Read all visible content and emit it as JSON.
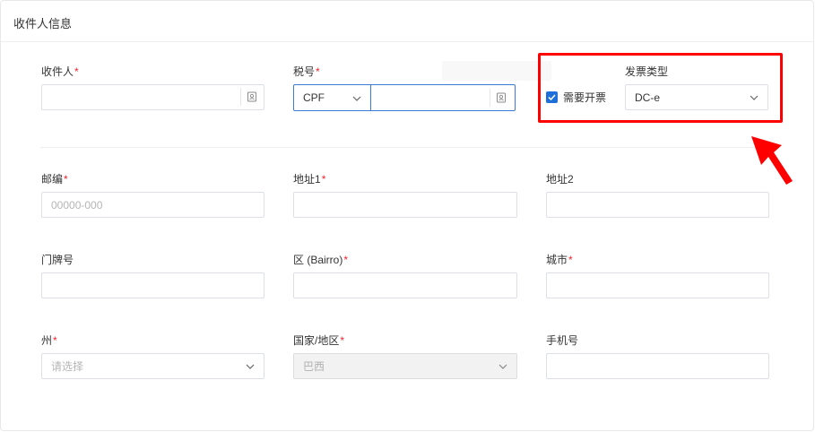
{
  "section": {
    "title": "收件人信息"
  },
  "required_mark": "*",
  "fields": {
    "recipient": {
      "label": "收件人",
      "value": "",
      "placeholder": ""
    },
    "tax": {
      "label": "税号",
      "type_value": "CPF",
      "value": "",
      "placeholder": ""
    },
    "invoice": {
      "checkbox_label": "需要开票",
      "checked": true,
      "type_label": "发票类型",
      "type_value": "DC-e"
    },
    "zip": {
      "label": "邮编",
      "value": "",
      "placeholder": "00000-000"
    },
    "address1": {
      "label": "地址1",
      "value": "",
      "placeholder": ""
    },
    "address2": {
      "label": "地址2",
      "value": "",
      "placeholder": ""
    },
    "house_number": {
      "label": "门牌号",
      "value": "",
      "placeholder": ""
    },
    "district": {
      "label": "区 (Bairro)",
      "value": "",
      "placeholder": ""
    },
    "city": {
      "label": "城市",
      "value": "",
      "placeholder": ""
    },
    "state": {
      "label": "州",
      "placeholder": "请选择"
    },
    "country": {
      "label": "国家/地区",
      "value": "巴西",
      "disabled": true
    },
    "phone": {
      "label": "手机号",
      "value": "",
      "placeholder": ""
    }
  },
  "icons": {
    "contact_book": "contact-book-icon",
    "chevron": "chevron-down-icon",
    "check": "check-icon",
    "annotation_arrow": "arrow-icon"
  },
  "colors": {
    "required": "#f5222d",
    "focus_border": "#3b7bd4",
    "checkbox": "#1e6fd9",
    "highlight": "#ff0000"
  }
}
